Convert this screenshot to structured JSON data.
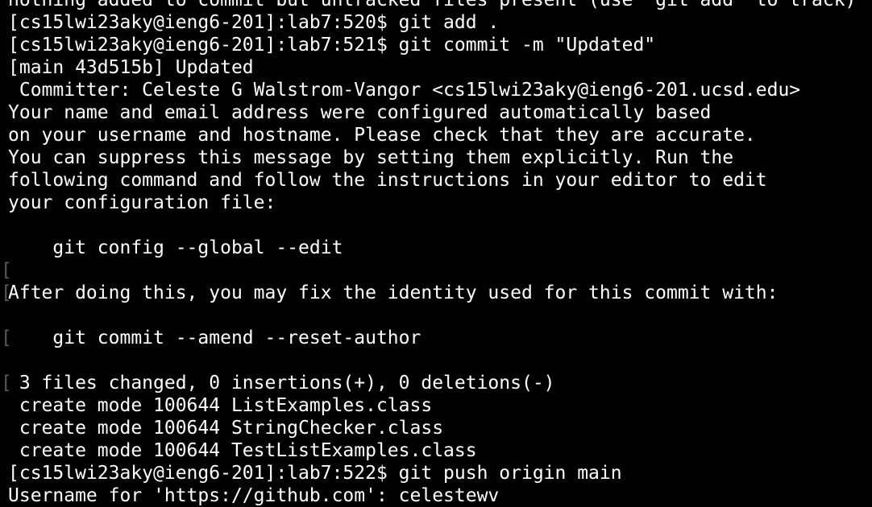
{
  "terminal": {
    "background": "#000000",
    "foreground": "#ffffff",
    "marker_color": "#5a5a5a",
    "lines": [
      "nothing added to commit but untracked files present (use \"git add\" to track)",
      "[cs15lwi23aky@ieng6-201]:lab7:520$ git add .",
      "[cs15lwi23aky@ieng6-201]:lab7:521$ git commit -m \"Updated\"",
      "[main 43d515b] Updated",
      " Committer: Celeste G Walstrom-Vangor <cs15lwi23aky@ieng6-201.ucsd.edu>",
      "Your name and email address were configured automatically based",
      "on your username and hostname. Please check that they are accurate.",
      "You can suppress this message by setting them explicitly. Run the",
      "following command and follow the instructions in your editor to edit",
      "your configuration file:",
      "",
      "    git config --global --edit",
      "",
      "After doing this, you may fix the identity used for this commit with:",
      "",
      "    git commit --amend --reset-author",
      "",
      " 3 files changed, 0 insertions(+), 0 deletions(-)",
      " create mode 100644 ListExamples.class",
      " create mode 100644 StringChecker.class",
      " create mode 100644 TestListExamples.class",
      "[cs15lwi23aky@ieng6-201]:lab7:522$ git push origin main",
      "Username for 'https://github.com': celestewv"
    ],
    "markers": {
      "12": "[",
      "13": "[",
      "15": "[",
      "17": "["
    }
  }
}
